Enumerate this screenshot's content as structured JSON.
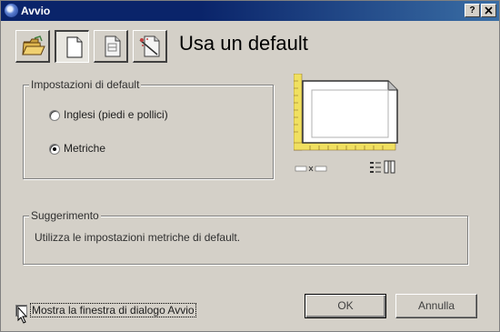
{
  "window": {
    "title": "Avvio",
    "help_label": "?",
    "close_label": "x"
  },
  "toolbar": {
    "buttons": [
      {
        "name": "open-drawing",
        "icon": "folder-open-icon",
        "pressed": false
      },
      {
        "name": "use-default",
        "icon": "blank-document-icon",
        "pressed": true
      },
      {
        "name": "use-template",
        "icon": "template-document-icon",
        "pressed": false
      },
      {
        "name": "use-wizard",
        "icon": "wizard-document-icon",
        "pressed": false
      }
    ]
  },
  "heading": "Usa un default",
  "defaults_group": {
    "legend": "Impostazioni di default",
    "options": [
      {
        "label": "Inglesi (piedi e pollici)",
        "selected": false
      },
      {
        "label": "Metriche",
        "selected": true
      }
    ]
  },
  "hint_group": {
    "legend": "Suggerimento",
    "text": "Utilizza le impostazioni metriche di default."
  },
  "footer": {
    "checkbox_label": "Mostra la finestra di dialogo Avvio",
    "checkbox_checked": false,
    "ok_label": "OK",
    "cancel_label": "Annulla"
  },
  "colors": {
    "title_bar": "#0a246a",
    "ruler_yellow": "#f0e060",
    "face": "#d4d0c8"
  }
}
